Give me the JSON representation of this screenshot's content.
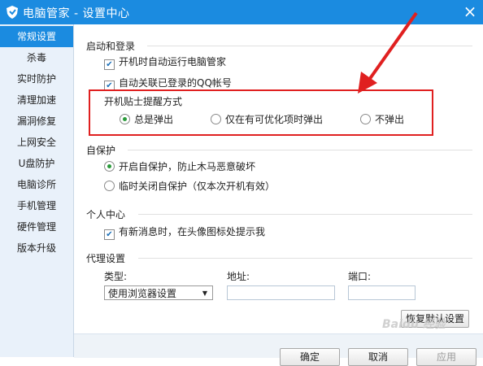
{
  "window": {
    "title": "电脑管家 - 设置中心"
  },
  "sidebar": {
    "items": [
      {
        "label": "常规设置",
        "active": true
      },
      {
        "label": "杀毒"
      },
      {
        "label": "实时防护"
      },
      {
        "label": "清理加速"
      },
      {
        "label": "漏洞修复"
      },
      {
        "label": "上网安全"
      },
      {
        "label": "U盘防护"
      },
      {
        "label": "电脑诊所"
      },
      {
        "label": "手机管理"
      },
      {
        "label": "硬件管理"
      },
      {
        "label": "版本升级"
      }
    ]
  },
  "startup": {
    "title": "启动和登录",
    "autorun": {
      "label": "开机时自动运行电脑管家",
      "checked": true
    },
    "associate_qq": {
      "label": "自动关联已登录的QQ帐号",
      "checked": true
    },
    "popup": {
      "title": "开机贴士提醒方式",
      "options": [
        {
          "label": "总是弹出",
          "selected": true
        },
        {
          "label": "仅在有可优化项时弹出",
          "selected": false
        },
        {
          "label": "不弹出",
          "selected": false
        }
      ]
    }
  },
  "self_protect": {
    "title": "自保护",
    "options": [
      {
        "label": "开启自保护，防止木马恶意破坏",
        "selected": true
      },
      {
        "label": "临时关闭自保护（仅本次开机有效）",
        "selected": false
      }
    ]
  },
  "personal": {
    "title": "个人中心",
    "new_msg": {
      "label": "有新消息时，在头像图标处提示我",
      "checked": true
    }
  },
  "proxy": {
    "title": "代理设置",
    "type_label": "类型:",
    "type_value": "使用浏览器设置",
    "address_label": "地址:",
    "port_label": "端口:",
    "restore_default": "恢复默认设置"
  },
  "footer": {
    "ok": "确定",
    "cancel": "取消",
    "apply": "应用"
  },
  "watermark": "Baidu 经验",
  "colors": {
    "accent": "#1b8be0",
    "highlight": "#e02020",
    "radio_dot": "#2a9a3a"
  }
}
